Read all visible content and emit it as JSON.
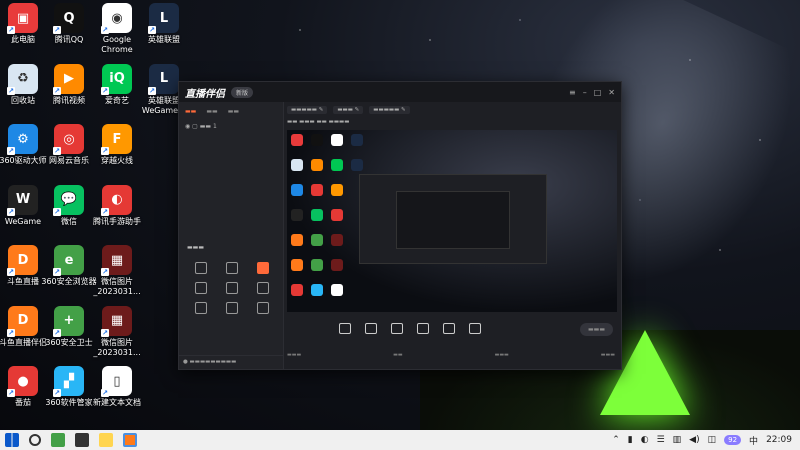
{
  "desktop": {
    "icons": [
      {
        "label": "此电脑",
        "glyph": "▣",
        "color": "#e83b3b",
        "col": 0,
        "row": 0
      },
      {
        "label": "腾讯QQ",
        "glyph": "Q",
        "color": "#111111",
        "col": 1,
        "row": 0
      },
      {
        "label": "Google Chrome",
        "glyph": "◉",
        "color": "#ffffff",
        "col": 2,
        "row": 0
      },
      {
        "label": "英雄联盟",
        "glyph": "L",
        "color": "#1b2b44",
        "col": 3,
        "row": 0
      },
      {
        "label": "回收站",
        "glyph": "♻",
        "color": "#d9e6f2",
        "col": 0,
        "row": 1
      },
      {
        "label": "腾讯视频",
        "glyph": "▶",
        "color": "#ff8a00",
        "col": 1,
        "row": 1
      },
      {
        "label": "爱奇艺",
        "glyph": "iQ",
        "color": "#00c853",
        "col": 2,
        "row": 1
      },
      {
        "label": "英雄联盟WeGame版",
        "glyph": "L",
        "color": "#1b2b44",
        "col": 3,
        "row": 1
      },
      {
        "label": "360驱动大师",
        "glyph": "⚙",
        "color": "#1e88e5",
        "col": 0,
        "row": 2
      },
      {
        "label": "网易云音乐",
        "glyph": "◎",
        "color": "#e53935",
        "col": 1,
        "row": 2
      },
      {
        "label": "穿越火线",
        "glyph": "F",
        "color": "#ff9800",
        "col": 2,
        "row": 2
      },
      {
        "label": "WeGame",
        "glyph": "W",
        "color": "#222222",
        "col": 0,
        "row": 3
      },
      {
        "label": "微信",
        "glyph": "💬",
        "color": "#07c160",
        "col": 1,
        "row": 3
      },
      {
        "label": "腾讯手游助手",
        "glyph": "◐",
        "color": "#e53935",
        "col": 2,
        "row": 3
      },
      {
        "label": "斗鱼直播",
        "glyph": "D",
        "color": "#ff7a1a",
        "col": 0,
        "row": 4
      },
      {
        "label": "360安全浏览器",
        "glyph": "e",
        "color": "#43a047",
        "col": 1,
        "row": 4
      },
      {
        "label": "微信图片_2023031...",
        "glyph": "▦",
        "color": "#6d1b1b",
        "col": 2,
        "row": 4
      },
      {
        "label": "斗鱼直播伴侣",
        "glyph": "D",
        "color": "#ff7a1a",
        "col": 0,
        "row": 5
      },
      {
        "label": "360安全卫士",
        "glyph": "+",
        "color": "#43a047",
        "col": 1,
        "row": 5
      },
      {
        "label": "微信图片_2023031...",
        "glyph": "▦",
        "color": "#6d1b1b",
        "col": 2,
        "row": 5
      },
      {
        "label": "番茄",
        "glyph": "●",
        "color": "#e53935",
        "col": 0,
        "row": 6
      },
      {
        "label": "360软件管家",
        "glyph": "▞",
        "color": "#29b6f6",
        "col": 1,
        "row": 6
      },
      {
        "label": "新建文本文档",
        "glyph": "▯",
        "color": "#ffffff",
        "col": 2,
        "row": 6
      }
    ]
  },
  "app": {
    "title": "直播伴侣",
    "version_pill": "新版"
  },
  "taskbar": {
    "time": "22:09",
    "badge": "92"
  },
  "colors": {
    "accent": "#ff6a3a",
    "taskbar": "#f0f0f0"
  }
}
